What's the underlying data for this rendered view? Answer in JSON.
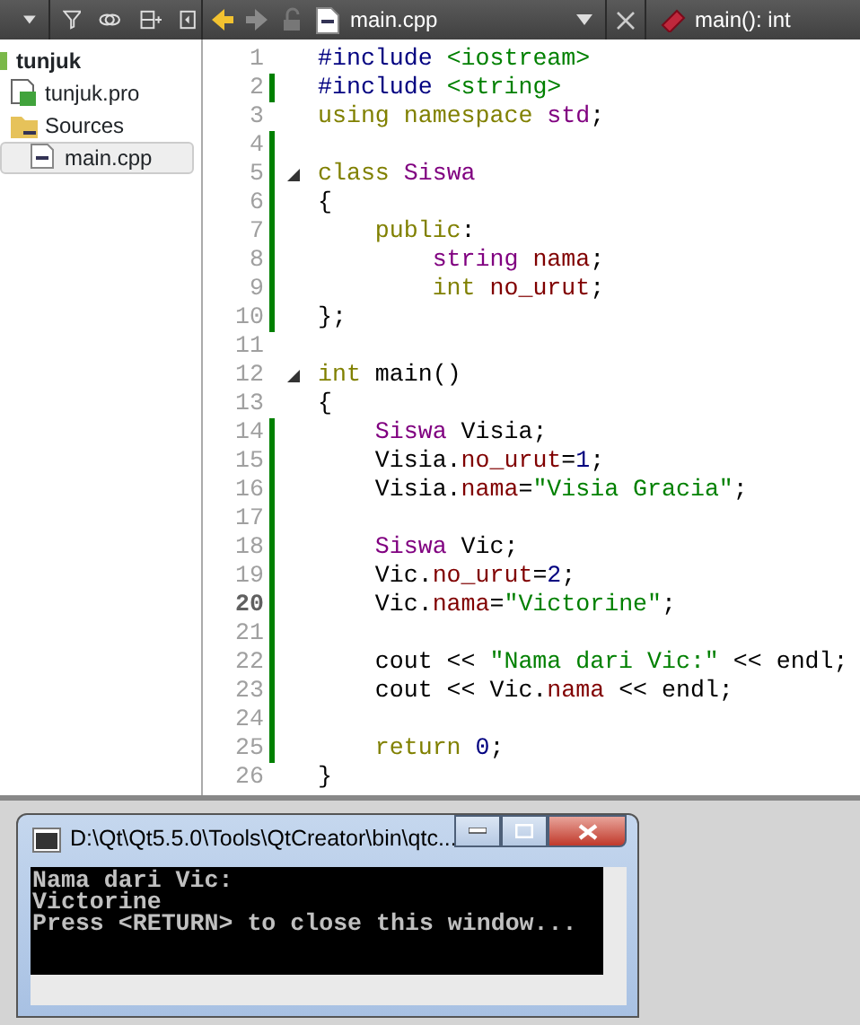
{
  "sidebar_toolbar": {
    "buttons": [
      {
        "kind": "caret"
      },
      {
        "kind": "filter"
      },
      {
        "kind": "link"
      },
      {
        "kind": "split"
      },
      {
        "kind": "close-pane"
      }
    ]
  },
  "project_tree": [
    {
      "label": "tunjuk",
      "kind": "project",
      "selected": false,
      "children": [
        {
          "label": "tunjuk.pro",
          "kind": "pro-file",
          "selected": false
        },
        {
          "label": "Sources",
          "kind": "folder",
          "selected": false,
          "children": [
            {
              "label": "main.cpp",
              "kind": "cpp-file",
              "selected": true
            }
          ]
        }
      ]
    }
  ],
  "editor_toolbar": {
    "nav": [
      {
        "kind": "back",
        "disabled": false
      },
      {
        "kind": "forward",
        "disabled": true
      }
    ],
    "file_name": "main.cpp",
    "symbol": "main(): int"
  },
  "code_lines": [
    {
      "number": "1",
      "modified": false,
      "fold": false,
      "current": false,
      "tokens": [
        {
          "kind": "preproc",
          "text": "#include"
        },
        {
          "kind": "include",
          "text": " <iostream>"
        }
      ]
    },
    {
      "number": "2",
      "modified": true,
      "fold": false,
      "current": false,
      "tokens": [
        {
          "kind": "preproc",
          "text": "#include"
        },
        {
          "kind": "include",
          "text": " <string>"
        }
      ]
    },
    {
      "number": "3",
      "modified": false,
      "fold": false,
      "current": false,
      "tokens": [
        {
          "kind": "keyword",
          "text": "using namespace"
        },
        {
          "kind": "type",
          "text": " std"
        },
        {
          "kind": "plain",
          "text": ";"
        }
      ]
    },
    {
      "number": "4",
      "modified": true,
      "fold": false,
      "current": false
    },
    {
      "number": "5",
      "modified": true,
      "fold": true,
      "current": false,
      "tokens": [
        {
          "kind": "keyword",
          "text": "class"
        },
        {
          "kind": "type",
          "text": " Siswa"
        }
      ]
    },
    {
      "number": "6",
      "modified": true,
      "fold": false,
      "current": false,
      "tokens": [
        {
          "kind": "plain",
          "text": "{"
        }
      ]
    },
    {
      "number": "7",
      "modified": true,
      "fold": false,
      "current": false,
      "tokens": [
        {
          "kind": "keyword",
          "text": "    public"
        },
        {
          "kind": "plain",
          "text": ":"
        }
      ]
    },
    {
      "number": "8",
      "modified": true,
      "fold": false,
      "current": false,
      "tokens": [
        {
          "kind": "type",
          "text": "        string"
        },
        {
          "kind": "field",
          "text": " nama"
        },
        {
          "kind": "plain",
          "text": ";"
        }
      ]
    },
    {
      "number": "9",
      "modified": true,
      "fold": false,
      "current": false,
      "tokens": [
        {
          "kind": "keyword",
          "text": "        int"
        },
        {
          "kind": "field",
          "text": " no_urut"
        },
        {
          "kind": "plain",
          "text": ";"
        }
      ]
    },
    {
      "number": "10",
      "modified": true,
      "fold": false,
      "current": false,
      "tokens": [
        {
          "kind": "plain",
          "text": "};"
        }
      ]
    },
    {
      "number": "11",
      "modified": false,
      "fold": false,
      "current": false
    },
    {
      "number": "12",
      "modified": false,
      "fold": true,
      "current": false,
      "tokens": [
        {
          "kind": "keyword",
          "text": "int"
        },
        {
          "kind": "plain",
          "text": " main()"
        }
      ]
    },
    {
      "number": "13",
      "modified": false,
      "fold": false,
      "current": false,
      "tokens": [
        {
          "kind": "plain",
          "text": "{"
        }
      ]
    },
    {
      "number": "14",
      "modified": true,
      "fold": false,
      "current": false,
      "tokens": [
        {
          "kind": "type",
          "text": "    Siswa"
        },
        {
          "kind": "plain",
          "text": " Visia;"
        }
      ]
    },
    {
      "number": "15",
      "modified": true,
      "fold": false,
      "current": false,
      "tokens": [
        {
          "kind": "plain",
          "text": "    Visia."
        },
        {
          "kind": "field",
          "text": "no_urut"
        },
        {
          "kind": "plain",
          "text": "="
        },
        {
          "kind": "number",
          "text": "1"
        },
        {
          "kind": "plain",
          "text": ";"
        }
      ]
    },
    {
      "number": "16",
      "modified": true,
      "fold": false,
      "current": false,
      "tokens": [
        {
          "kind": "plain",
          "text": "    Visia."
        },
        {
          "kind": "field",
          "text": "nama"
        },
        {
          "kind": "plain",
          "text": "="
        },
        {
          "kind": "string",
          "text": "\"Visia Gracia\""
        },
        {
          "kind": "plain",
          "text": ";"
        }
      ]
    },
    {
      "number": "17",
      "modified": true,
      "fold": false,
      "current": false
    },
    {
      "number": "18",
      "modified": true,
      "fold": false,
      "current": false,
      "tokens": [
        {
          "kind": "type",
          "text": "    Siswa"
        },
        {
          "kind": "plain",
          "text": " Vic;"
        }
      ]
    },
    {
      "number": "19",
      "modified": true,
      "fold": false,
      "current": false,
      "tokens": [
        {
          "kind": "plain",
          "text": "    Vic."
        },
        {
          "kind": "field",
          "text": "no_urut"
        },
        {
          "kind": "plain",
          "text": "="
        },
        {
          "kind": "number",
          "text": "2"
        },
        {
          "kind": "plain",
          "text": ";"
        }
      ]
    },
    {
      "number": "20",
      "modified": true,
      "fold": false,
      "current": true,
      "tokens": [
        {
          "kind": "plain",
          "text": "    Vic."
        },
        {
          "kind": "field",
          "text": "nama"
        },
        {
          "kind": "plain",
          "text": "="
        },
        {
          "kind": "string",
          "text": "\"Victorine\""
        },
        {
          "kind": "plain",
          "text": ";"
        }
      ]
    },
    {
      "number": "21",
      "modified": true,
      "fold": false,
      "current": false
    },
    {
      "number": "22",
      "modified": true,
      "fold": false,
      "current": false,
      "tokens": [
        {
          "kind": "plain",
          "text": "    cout <<"
        },
        {
          "kind": "string",
          "text": " \"Nama dari Vic:\""
        },
        {
          "kind": "plain",
          "text": " << endl;"
        }
      ]
    },
    {
      "number": "23",
      "modified": true,
      "fold": false,
      "current": false,
      "tokens": [
        {
          "kind": "plain",
          "text": "    cout << Vic."
        },
        {
          "kind": "field",
          "text": "nama"
        },
        {
          "kind": "plain",
          "text": " << endl;"
        }
      ]
    },
    {
      "number": "24",
      "modified": true,
      "fold": false,
      "current": false
    },
    {
      "number": "25",
      "modified": true,
      "fold": false,
      "current": false,
      "tokens": [
        {
          "kind": "keyword",
          "text": "    return"
        },
        {
          "kind": "number",
          "text": " 0"
        },
        {
          "kind": "plain",
          "text": ";"
        }
      ]
    },
    {
      "number": "26",
      "modified": false,
      "fold": false,
      "current": false,
      "tokens": [
        {
          "kind": "plain",
          "text": "}"
        }
      ]
    }
  ],
  "console_window": {
    "title": "D:\\Qt\\Qt5.5.0\\Tools\\QtCreator\\bin\\qtc...",
    "output": [
      "Nama dari Vic:",
      "Victorine",
      "Press <RETURN> to close this window..."
    ]
  }
}
